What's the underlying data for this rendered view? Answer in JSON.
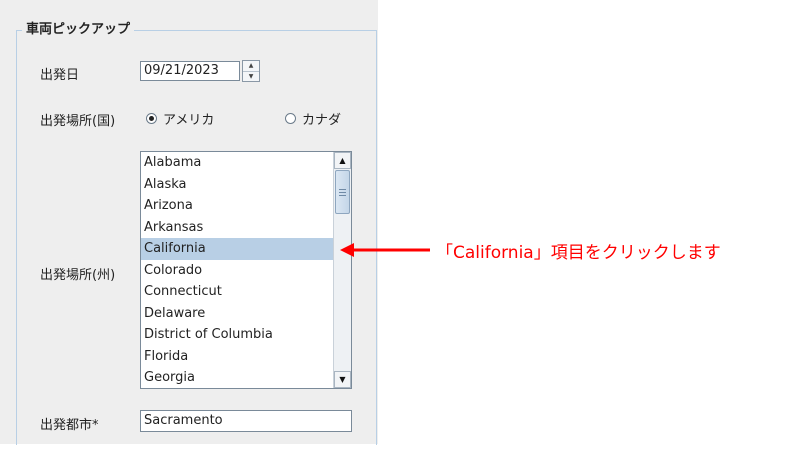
{
  "group": {
    "title": "車両ピックアップ"
  },
  "labels": {
    "departure_date": "出発日",
    "departure_country": "出発場所(国)",
    "departure_state": "出発場所(州)",
    "departure_city": "出発都市*"
  },
  "date": {
    "value": "09/21/2023",
    "spin_up": "▲",
    "spin_down": "▼"
  },
  "country": {
    "options": [
      {
        "label": "アメリカ",
        "checked": true
      },
      {
        "label": "カナダ",
        "checked": false
      }
    ]
  },
  "states": {
    "items": [
      "Alabama",
      "Alaska",
      "Arizona",
      "Arkansas",
      "California",
      "Colorado",
      "Connecticut",
      "Delaware",
      "District of Columbia",
      "Florida",
      "Georgia"
    ],
    "selected": "California",
    "scroll_up": "▲",
    "scroll_down": "▼"
  },
  "city": {
    "value": "Sacramento"
  },
  "annotation": {
    "text": "「California」項目をクリックします",
    "color": "#ff0000"
  }
}
